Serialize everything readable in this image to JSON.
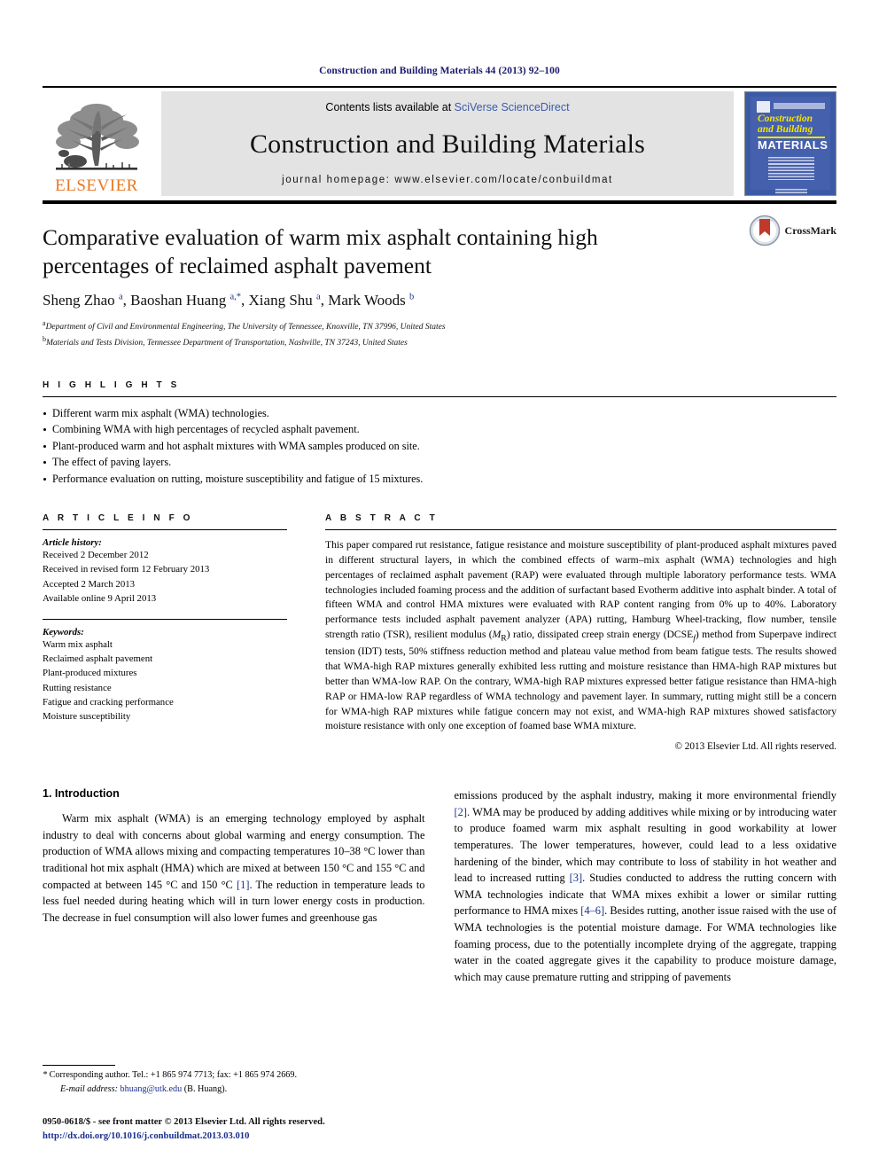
{
  "running_head": "Construction and Building Materials 44 (2013) 92–100",
  "masthead": {
    "publisher_name": "ELSEVIER",
    "contents_prefix": "Contents lists available at ",
    "contents_link": "SciVerse ScienceDirect",
    "journal_title": "Construction and Building Materials",
    "homepage": "journal homepage: www.elsevier.com/locate/conbuildmat",
    "cover": {
      "line1": "Construction",
      "line2": "and Building",
      "line3": "MATERIALS"
    }
  },
  "article": {
    "title": "Comparative evaluation of warm mix asphalt containing high percentages of reclaimed asphalt pavement",
    "authors_html": "Sheng Zhao <sup>a</sup>, Baoshan Huang <sup>a,*</sup>, Xiang Shu <sup>a</sup>, Mark Woods <sup>b</sup>",
    "affiliations": [
      "Department of Civil and Environmental Engineering, The University of Tennessee, Knoxville, TN 37996, United States",
      "Materials and Tests Division, Tennessee Department of Transportation, Nashville, TN 37243, United States"
    ],
    "affiliation_marks": [
      "a",
      "b"
    ],
    "crossmark_label": "CrossMark"
  },
  "highlights": {
    "heading": "H I G H L I G H T S",
    "items": [
      "Different warm mix asphalt (WMA) technologies.",
      "Combining WMA with high percentages of recycled asphalt pavement.",
      "Plant-produced warm and hot asphalt mixtures with WMA samples produced on site.",
      "The effect of paving layers.",
      "Performance evaluation on rutting, moisture susceptibility and fatigue of 15 mixtures."
    ]
  },
  "article_info": {
    "heading": "A R T I C L E  I N F O",
    "history_label": "Article history:",
    "history": [
      "Received 2 December 2012",
      "Received in revised form 12 February 2013",
      "Accepted 2 March 2013",
      "Available online 9 April 2013"
    ],
    "keywords_label": "Keywords:",
    "keywords": [
      "Warm mix asphalt",
      "Reclaimed asphalt pavement",
      "Plant-produced mixtures",
      "Rutting resistance",
      "Fatigue and cracking performance",
      "Moisture susceptibility"
    ]
  },
  "abstract": {
    "heading": "A B S T R A C T",
    "text_html": "This paper compared rut resistance, fatigue resistance and moisture susceptibility of plant-produced asphalt mixtures paved in different structural layers, in which the combined effects of warm&ndash;mix asphalt (WMA) technologies and high percentages of reclaimed asphalt pavement (RAP) were evaluated through multiple laboratory performance tests. WMA technologies included foaming process and the addition of surfactant based Evotherm additive into asphalt binder. A total of fifteen WMA and control HMA mixtures were evaluated with RAP content ranging from 0% up to 40%. Laboratory performance tests included asphalt pavement analyzer (APA) rutting, Hamburg Wheel-tracking, flow number, tensile strength ratio (TSR), resilient modulus (<i>M</i><sub>R</sub>) ratio, dissipated creep strain energy (DCSE<sub><i>f</i></sub>) method from Superpave indirect tension (IDT) tests, 50% stiffness reduction method and plateau value method from beam fatigue tests. The results showed that WMA-high RAP mixtures generally exhibited less rutting and moisture resistance than HMA-high RAP mixtures but better than WMA-low RAP. On the contrary, WMA-high RAP mixtures expressed better fatigue resistance than HMA-high RAP or HMA-low RAP regardless of WMA technology and pavement layer. In summary, rutting might still be a concern for WMA-high RAP mixtures while fatigue concern may not exist, and WMA-high RAP mixtures showed satisfactory moisture resistance with only one exception of foamed base WMA mixture.",
    "copyright": "© 2013 Elsevier Ltd. All rights reserved."
  },
  "introduction": {
    "title": "1. Introduction",
    "left_paragraph_html": "Warm mix asphalt (WMA) is an emerging technology employed by asphalt industry to deal with concerns about global warming and energy consumption. The production of WMA allows mixing and compacting temperatures 10&ndash;38 &deg;C lower than traditional hot mix asphalt (HMA) which are mixed at between 150 &deg;C and 155 &deg;C and compacted at between 145 &deg;C and 150 &deg;C <span class=\"ref\">[1]</span>. The reduction in temperature leads to less fuel needed during heating which will in turn lower energy costs in production. The decrease in fuel consumption will also lower fumes and greenhouse gas",
    "right_paragraph_html": "emissions produced by the asphalt industry, making it more environmental friendly <span class=\"ref\">[2]</span>. WMA may be produced by adding additives while mixing or by introducing water to produce foamed warm mix asphalt resulting in good workability at lower temperatures. The lower temperatures, however, could lead to a less oxidative hardening of the binder, which may contribute to loss of stability in hot weather and lead to increased rutting <span class=\"ref\">[3]</span>. Studies conducted to address the rutting concern with WMA technologies indicate that WMA mixes exhibit a lower or similar rutting performance to HMA mixes <span class=\"ref\">[4&ndash;6]</span>. Besides rutting, another issue raised with the use of WMA technologies is the potential moisture damage. For WMA technologies like foaming process, due to the potentially incomplete drying of the aggregate, trapping water in the coated aggregate gives it the capability to produce moisture damage, which may cause premature rutting and stripping of pavements"
  },
  "footer": {
    "corresponding_html": "<span class=\"em\">*</span> Corresponding author. Tel.: +1 865 974 7713; fax: +1 865 974 2669.",
    "email_html": "<span class=\"em\">E-mail address:</span> <span class=\"mail\">bhuang@utk.edu</span> (B. Huang).",
    "issn_line": "0950-0618/$ - see front matter © 2013 Elsevier Ltd. All rights reserved.",
    "doi_line": "http://dx.doi.org/10.1016/j.conbuildmat.2013.03.010"
  },
  "colors": {
    "running_head": "#1a1a6e",
    "link": "#1a2f8e",
    "elsevier_orange": "#E87722",
    "cover_blue": "#4560ad",
    "cover_yellow": "#f5e400",
    "masthead_gray": "#e3e3e3"
  }
}
